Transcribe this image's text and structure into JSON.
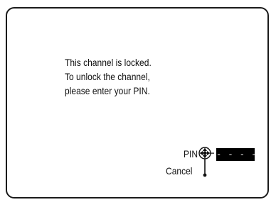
{
  "lock_dialog": {
    "message_lines": [
      "This channel is locked.",
      "To unlock the channel,",
      "please enter your PIN."
    ],
    "pin_label": "PIN",
    "pin_value": "- - - -",
    "cancel_label": "Cancel",
    "icons": {
      "navigation": "remote-nav-pad-icon"
    }
  }
}
